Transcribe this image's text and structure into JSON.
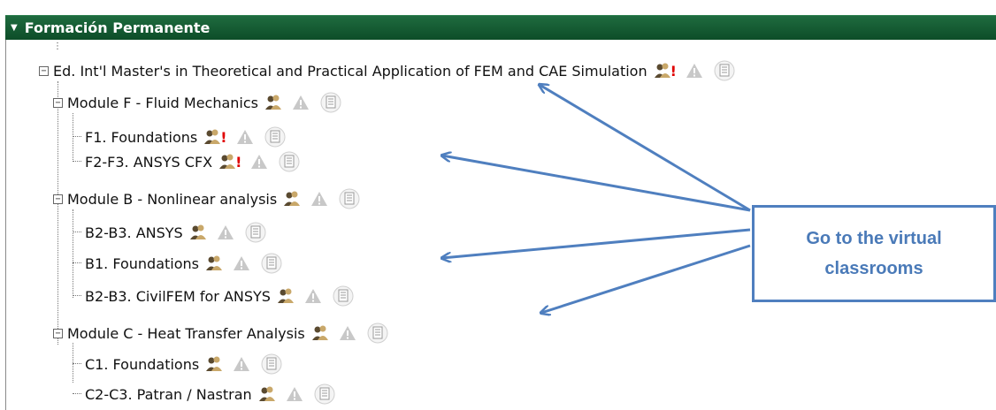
{
  "panel": {
    "title": "Formación Permanente",
    "caret": "▼"
  },
  "tree": {
    "root": {
      "label": "Ed. Int'l Master's in Theoretical and Practical Application of FEM and CAE Simulation",
      "alert": "!"
    },
    "modules": [
      {
        "label": "Module F - Fluid Mechanics",
        "items": [
          {
            "label": "F1. Foundations",
            "alert": "!"
          },
          {
            "label": "F2-F3. ANSYS CFX",
            "alert": "!"
          }
        ]
      },
      {
        "label": "Module B - Nonlinear analysis",
        "items": [
          {
            "label": "B2-B3. ANSYS"
          },
          {
            "label": "B1. Foundations"
          },
          {
            "label": "B2-B3. CivilFEM for ANSYS"
          }
        ]
      },
      {
        "label": "Module C - Heat Transfer Analysis",
        "items": [
          {
            "label": "C1. Foundations"
          },
          {
            "label": "C2-C3. Patran / Nastran"
          }
        ]
      }
    ]
  },
  "callout": {
    "line1": "Go to the virtual",
    "line2": "classrooms"
  },
  "icons": {
    "classroom": "people-icon",
    "warning": "warning-icon",
    "document": "document-icon"
  },
  "colors": {
    "header_bg": "#0d4d28",
    "callout": "#4f7fbf",
    "alert": "#e00000"
  }
}
